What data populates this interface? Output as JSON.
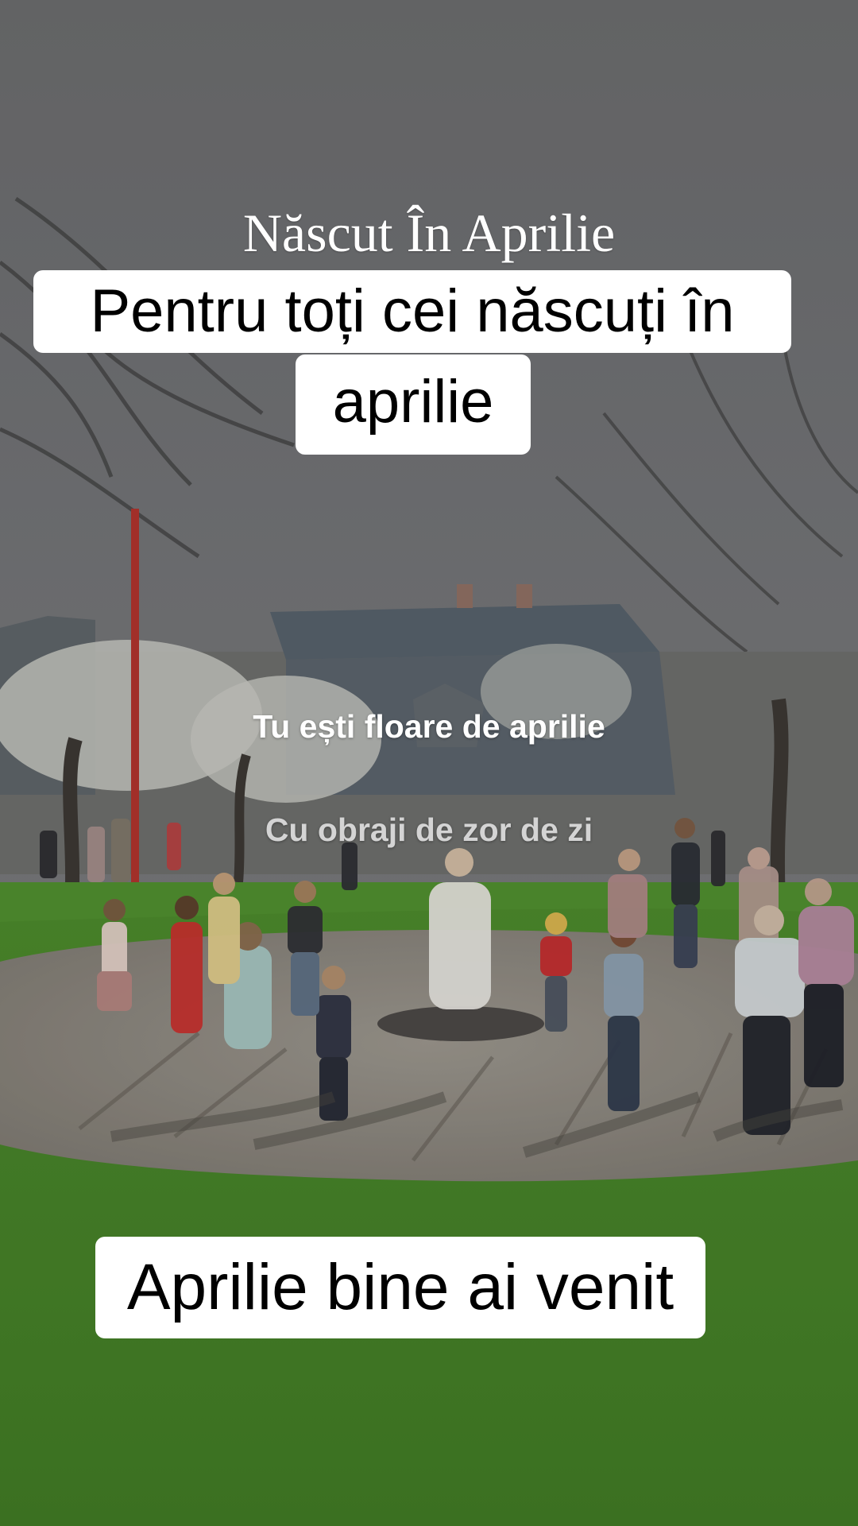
{
  "video": {
    "title_overlay": "Născut În Aprilie",
    "captions": {
      "top_line_1": "Pentru toți cei născuți în",
      "top_line_2": "aprilie",
      "bottom": "Aprilie bine ai venit"
    },
    "lyrics": {
      "current": "Tu ești floare de aprilie",
      "next": "Cu obraji de zor de zi"
    }
  },
  "colors": {
    "sky": "#6f7072",
    "grass": "#4f8f2c",
    "caption_background": "#ffffff",
    "caption_text": "#000000",
    "lyric_current": "#ffffff",
    "lyric_next": "#d4d4d4"
  }
}
